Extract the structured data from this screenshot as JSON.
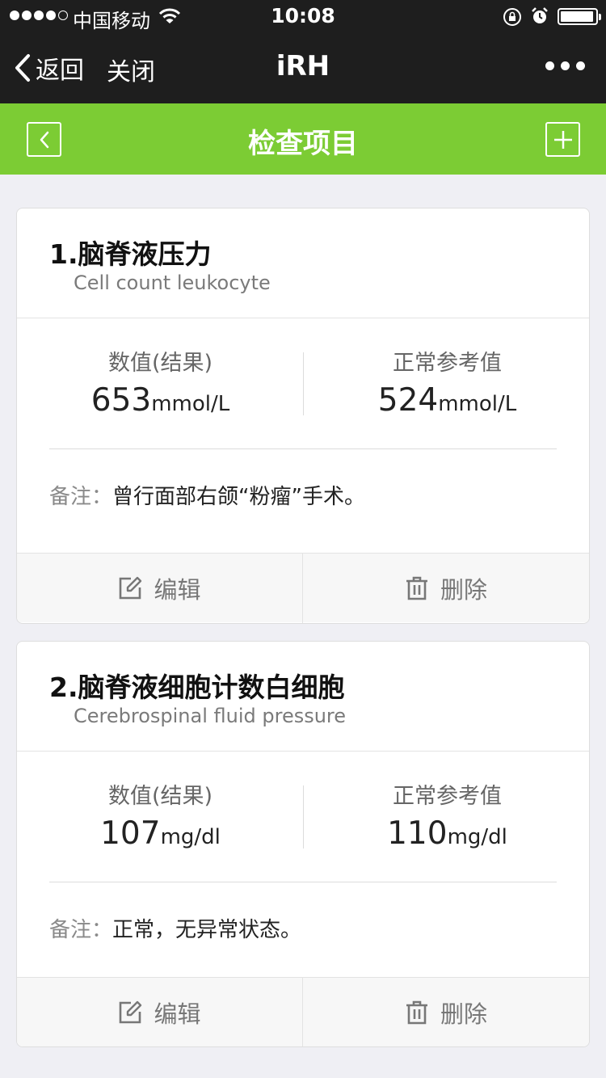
{
  "status_bar": {
    "carrier": "中国移动",
    "time": "10:08"
  },
  "nav": {
    "back_label": "返回",
    "close_label": "关闭",
    "title": "iRH"
  },
  "header": {
    "title": "检查项目"
  },
  "items": [
    {
      "title": "1.脑脊液压力",
      "subtitle": "Cell count leukocyte",
      "value_label": "数值(结果)",
      "value": "653",
      "value_unit": "mmol/L",
      "ref_label": "正常参考值",
      "ref_value": "524",
      "ref_unit": "mmol/L",
      "note_label": "备注：",
      "note": "曾行面部右颌“粉瘤”手术。",
      "edit_label": "编辑",
      "delete_label": "删除"
    },
    {
      "title": "2.脑脊液细胞计数白细胞",
      "subtitle": "Cerebrospinal fluid pressure",
      "value_label": "数值(结果)",
      "value": "107",
      "value_unit": "mg/dl",
      "ref_label": "正常参考值",
      "ref_value": "110",
      "ref_unit": "mg/dl",
      "note_label": "备注：",
      "note": "正常，无异常状态。",
      "edit_label": "编辑",
      "delete_label": "删除"
    }
  ],
  "colors": {
    "header_green": "#7ccc34",
    "nav_dark": "#1e1e1e",
    "background": "#efeff4"
  }
}
